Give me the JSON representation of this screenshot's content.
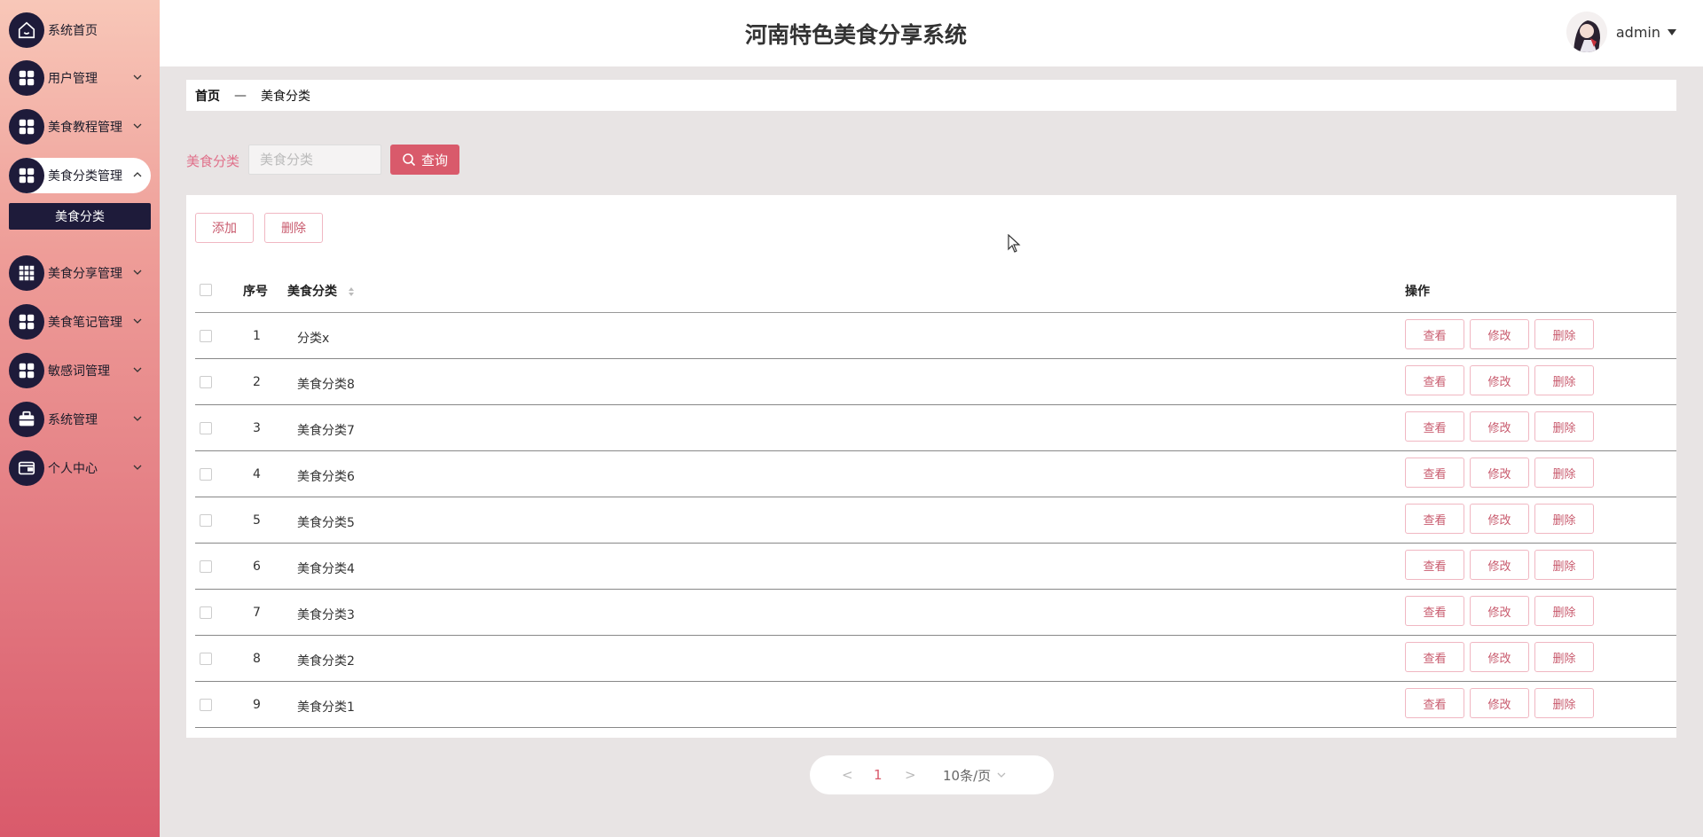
{
  "app": {
    "title": "河南特色美食分享系统"
  },
  "user": {
    "name": "admin"
  },
  "sidebar": {
    "items": [
      {
        "label": "系统首页",
        "icon": "home-icon"
      },
      {
        "label": "用户管理",
        "icon": "grid-icon"
      },
      {
        "label": "美食教程管理",
        "icon": "grid-icon"
      },
      {
        "label": "美食分类管理",
        "icon": "grid-icon",
        "expanded": true
      },
      {
        "label": "美食分享管理",
        "icon": "grid-nine-icon"
      },
      {
        "label": "美食笔记管理",
        "icon": "grid-icon"
      },
      {
        "label": "敏感词管理",
        "icon": "grid-icon"
      },
      {
        "label": "系统管理",
        "icon": "briefcase-icon"
      },
      {
        "label": "个人中心",
        "icon": "wallet-icon"
      }
    ],
    "submenu": {
      "label": "美食分类"
    }
  },
  "breadcrumb": {
    "home": "首页",
    "separator": "—",
    "current": "美食分类"
  },
  "search": {
    "label": "美食分类",
    "placeholder": "美食分类",
    "button": "查询"
  },
  "toolbar": {
    "add": "添加",
    "delete": "删除"
  },
  "table": {
    "headers": {
      "index": "序号",
      "category": "美食分类",
      "actions": "操作"
    },
    "action_labels": {
      "view": "查看",
      "edit": "修改",
      "delete": "删除"
    },
    "rows": [
      {
        "index": "1",
        "category": "分类x"
      },
      {
        "index": "2",
        "category": "美食分类8"
      },
      {
        "index": "3",
        "category": "美食分类7"
      },
      {
        "index": "4",
        "category": "美食分类6"
      },
      {
        "index": "5",
        "category": "美食分类5"
      },
      {
        "index": "6",
        "category": "美食分类4"
      },
      {
        "index": "7",
        "category": "美食分类3"
      },
      {
        "index": "8",
        "category": "美食分类2"
      },
      {
        "index": "9",
        "category": "美食分类1"
      }
    ]
  },
  "pagination": {
    "prev": "<",
    "page": "1",
    "next": ">",
    "page_size": "10条/页"
  },
  "colors": {
    "accent": "#d95a6b",
    "sidebar_dark": "#1e1b3a",
    "button_border": "#f0b7c2"
  }
}
